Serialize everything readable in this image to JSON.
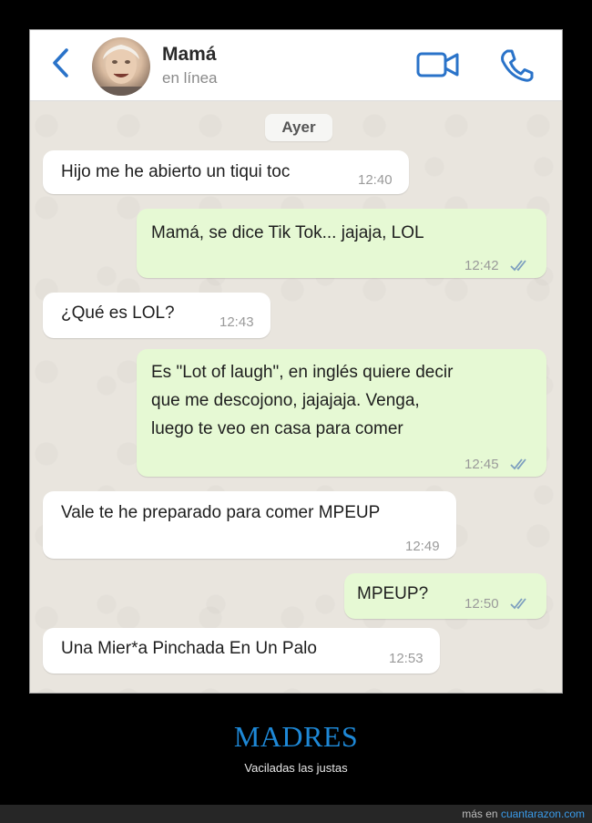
{
  "header": {
    "contact_name": "Mamá",
    "status": "en línea",
    "back_icon": "chevron-left-icon",
    "video_icon": "video-camera-icon",
    "call_icon": "phone-icon",
    "accent_color": "#2a73c9"
  },
  "chat": {
    "date_label": "Ayer",
    "messages": [
      {
        "direction": "in",
        "text": "Hijo me he abierto un tiqui toc",
        "time": "12:40"
      },
      {
        "direction": "out",
        "text": "Mamá, se dice Tik Tok... jajaja, LOL",
        "time": "12:42",
        "status": "read"
      },
      {
        "direction": "in",
        "text": "¿Qué es LOL?",
        "time": "12:43"
      },
      {
        "direction": "out",
        "lines": [
          "Es \"Lot of laugh\", en inglés quiere decir",
          "que me descojono, jajajaja. Venga,",
          "luego te veo en casa para comer"
        ],
        "time": "12:45",
        "status": "read"
      },
      {
        "direction": "in",
        "text": "Vale te he preparado para comer MPEUP",
        "time": "12:49"
      },
      {
        "direction": "out",
        "text": "MPEUP?",
        "time": "12:50",
        "status": "read"
      },
      {
        "direction": "in",
        "text": "Una Mier*a Pinchada En Un Palo",
        "time": "12:53"
      }
    ]
  },
  "caption": {
    "title": "MADRES",
    "subtitle": "Vaciladas las justas",
    "title_color": "#1e88d6"
  },
  "footer": {
    "prefix": "más en",
    "link": "cuantarazon.com"
  }
}
